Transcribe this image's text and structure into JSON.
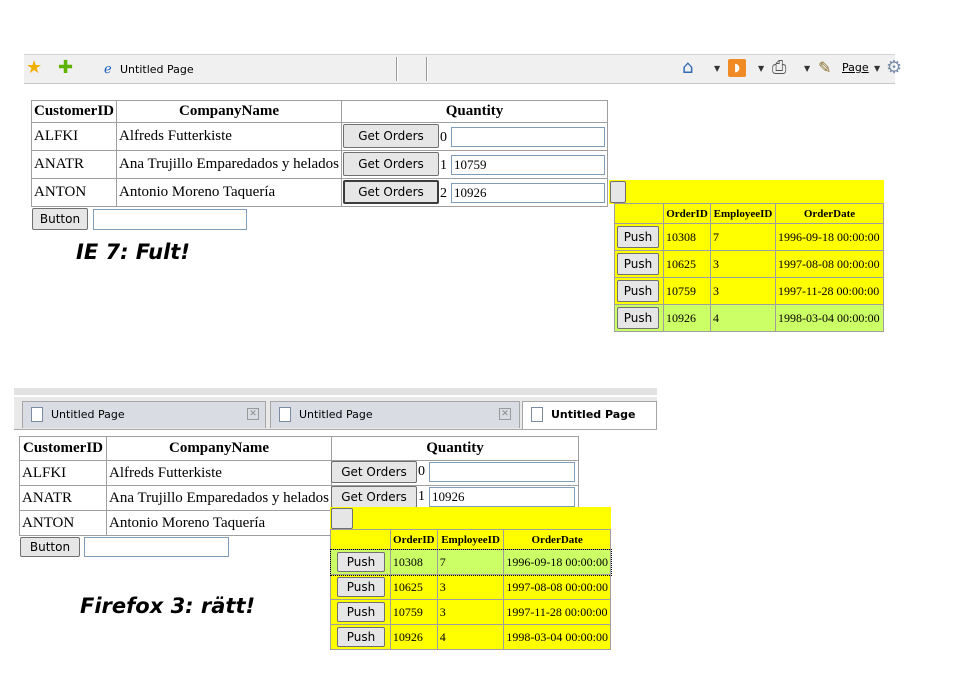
{
  "ie": {
    "tab_title": "Untitled Page",
    "page_menu": "Page",
    "grid": {
      "headers": [
        "CustomerID",
        "CompanyName",
        "Quantity"
      ],
      "rows": [
        {
          "id": "ALFKI",
          "name": "Alfreds Futterkiste",
          "button": "Get Orders",
          "index": "0",
          "value": ""
        },
        {
          "id": "ANATR",
          "name": "Ana Trujillo Emparedados y helados",
          "button": "Get Orders",
          "index": "1",
          "value": "10759"
        },
        {
          "id": "ANTON",
          "name": "Antonio Moreno Taquería",
          "button": "Get Orders",
          "index": "2",
          "value": "10926"
        }
      ]
    },
    "button": "Button",
    "orders": {
      "headers": [
        "OrderID",
        "EmployeeID",
        "OrderDate"
      ],
      "rows": [
        {
          "push": "Push",
          "order": "10308",
          "emp": "7",
          "date": "1996-09-18 00:00:00"
        },
        {
          "push": "Push",
          "order": "10625",
          "emp": "3",
          "date": "1997-08-08 00:00:00"
        },
        {
          "push": "Push",
          "order": "10759",
          "emp": "3",
          "date": "1997-11-28 00:00:00"
        },
        {
          "push": "Push",
          "order": "10926",
          "emp": "4",
          "date": "1998-03-04 00:00:00"
        }
      ]
    },
    "caption": "IE 7: Fult!"
  },
  "firefox": {
    "tabs": [
      "Untitled Page",
      "Untitled Page",
      "Untitled Page"
    ],
    "grid": {
      "headers": [
        "CustomerID",
        "CompanyName",
        "Quantity"
      ],
      "rows": [
        {
          "id": "ALFKI",
          "name": "Alfreds Futterkiste",
          "button": "Get Orders",
          "index": "0",
          "value": ""
        },
        {
          "id": "ANATR",
          "name": "Ana Trujillo Emparedados y helados",
          "button": "Get Orders",
          "index": "1",
          "value": "10926"
        },
        {
          "id": "ANTON",
          "name": "Antonio Moreno Taquería"
        }
      ]
    },
    "button": "Button",
    "orders": {
      "headers": [
        "OrderID",
        "EmployeeID",
        "OrderDate"
      ],
      "rows": [
        {
          "push": "Push",
          "order": "10308",
          "emp": "7",
          "date": "1996-09-18 00:00:00"
        },
        {
          "push": "Push",
          "order": "10625",
          "emp": "3",
          "date": "1997-08-08 00:00:00"
        },
        {
          "push": "Push",
          "order": "10759",
          "emp": "3",
          "date": "1997-11-28 00:00:00"
        },
        {
          "push": "Push",
          "order": "10926",
          "emp": "4",
          "date": "1998-03-04 00:00:00"
        }
      ]
    },
    "caption": "Firefox 3: rätt!"
  },
  "colors": {
    "grid_yellow": "#ffff00",
    "row_highlight": "#ccff66",
    "ie_toolbar": "#f0f0f0"
  }
}
